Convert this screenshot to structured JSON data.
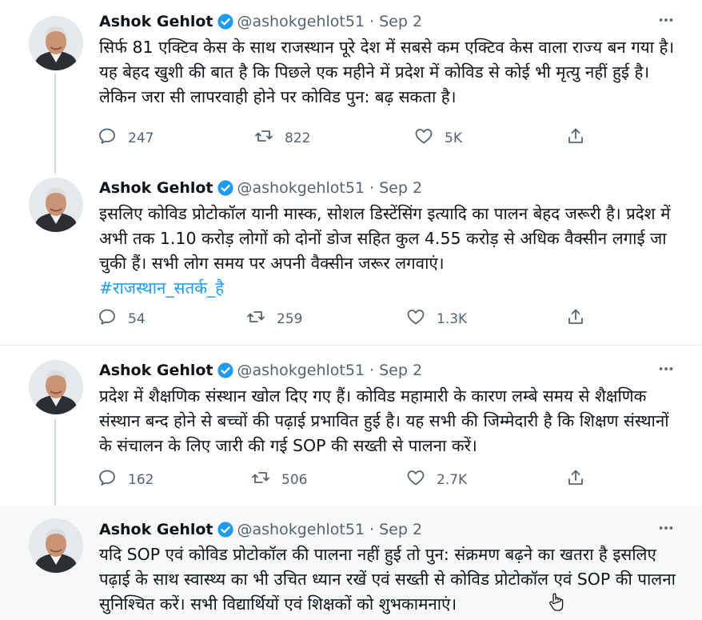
{
  "tweets": [
    {
      "author": "Ashok Gehlot",
      "handle": "@ashokgehlot51",
      "date": "Sep 2",
      "text": "सिर्फ 81 एक्टिव केस के साथ राजस्थान पूरे देश में सबसे कम एक्टिव केस वाला राज्य बन गया है। यह बेहद खुशी की बात है कि पिछले एक महीने में प्रदेश में कोविड से कोई भी मृत्यु नहीं हुई है। लेकिन जरा सी लापरवाही होने पर कोविड पुन: बढ़ सकता है।",
      "hashtag": "",
      "replies": "247",
      "retweets": "822",
      "likes": "5K"
    },
    {
      "author": "Ashok Gehlot",
      "handle": "@ashokgehlot51",
      "date": "Sep 2",
      "text": "इसलिए कोविड प्रोटोकॉल यानी मास्क, सोशल डिस्टेंसिंग इत्यादि का पालन बेहद जरूरी है। प्रदेश में अभी तक 1.10 करोड़ लोगों को दोनों डोज सहित कुल 4.55 करोड़ से अधिक वैक्सीन लगाई जा चुकी हैं। सभी लोग समय पर अपनी वैक्सीन जरूर लगवाएं।",
      "hashtag": "#राजस्थान_सतर्क_है",
      "replies": "54",
      "retweets": "259",
      "likes": "1.3K"
    },
    {
      "author": "Ashok Gehlot",
      "handle": "@ashokgehlot51",
      "date": "Sep 2",
      "text": "प्रदेश में शैक्षणिक संस्थान खोल दिए गए हैं। कोविड महामारी के कारण लम्बे समय से शैक्षणिक संस्थान बन्द होने से बच्चों की पढ़ाई प्रभावित हुई है। यह सभी की जिम्मेदारी है कि शिक्षण संस्थानों के संचालन के लिए जारी की गई SOP की सख्ती से पालना करें।",
      "hashtag": "",
      "replies": "162",
      "retweets": "506",
      "likes": "2.7K"
    },
    {
      "author": "Ashok Gehlot",
      "handle": "@ashokgehlot51",
      "date": "Sep 2",
      "text": "यदि SOP एवं कोविड प्रोटोकॉल की पालना नहीं हुई तो पुन: संक्रमण बढ़ने का खतरा है इसलिए पढ़ाई के साथ स्वास्थ्य का भी उचित ध्यान रखें एवं सख्ती से कोविड प्रोटोकॉल एवं SOP की पालना सुनिश्चित करें। सभी विद्यार्थियों एवं शिक्षकों को शुभकामनाएं।",
      "hashtag": "",
      "replies": "",
      "retweets": "",
      "likes": ""
    }
  ],
  "colors": {
    "accent": "#1d9bf0",
    "secondary_text": "#536471",
    "hover_bg": "#f7f9f9"
  },
  "icons": [
    "verified-badge-icon",
    "more-options-icon",
    "reply-icon",
    "retweet-icon",
    "like-icon",
    "share-icon"
  ]
}
